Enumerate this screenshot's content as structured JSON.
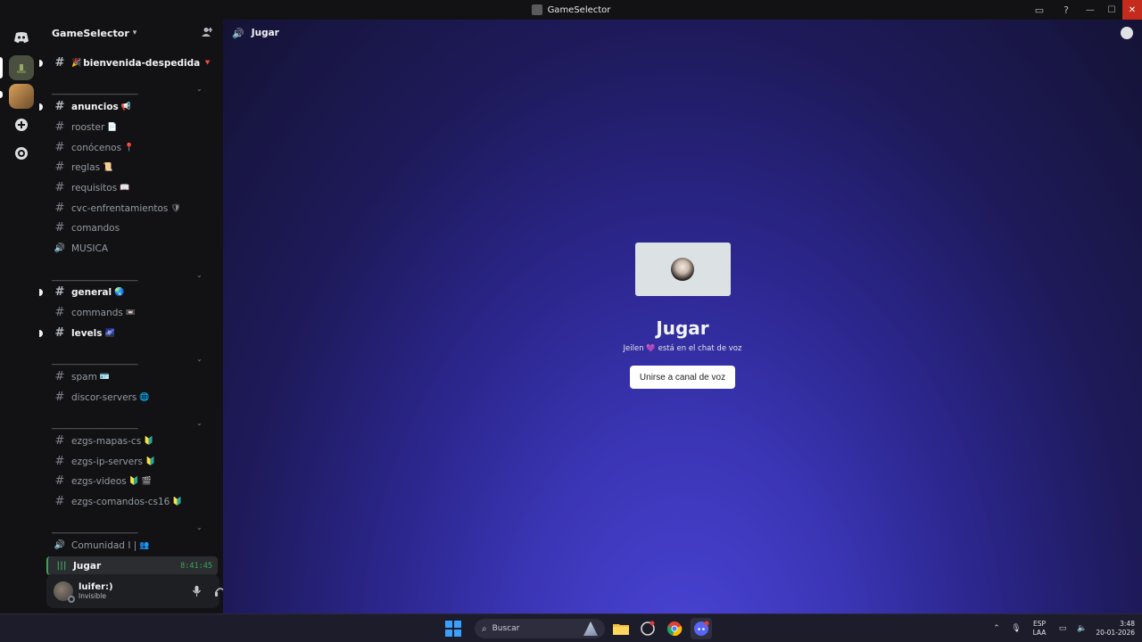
{
  "window": {
    "title": "GameSelector"
  },
  "guild": {
    "name": "GameSelector"
  },
  "channels": {
    "c0": {
      "label": "bienvenida-despedida",
      "emoji_pre": "🎉",
      "emoji_post": "🔻"
    },
    "c1": {
      "label": "anuncios",
      "emoji": "📢"
    },
    "c2": {
      "label": "rooster",
      "emoji": "📄"
    },
    "c3": {
      "label": "conócenos",
      "emoji": "📍"
    },
    "c4": {
      "label": "reglas",
      "emoji": "📜"
    },
    "c5": {
      "label": "requisitos",
      "emoji": "📖"
    },
    "c6": {
      "label": "cvc-enfrentamientos",
      "emoji": "🛡"
    },
    "c7": {
      "label": "comandos"
    },
    "c8": {
      "label": "MUSICA"
    },
    "c9": {
      "label": "general",
      "emoji": "🌏"
    },
    "c10": {
      "label": "commands",
      "emoji": "📼"
    },
    "c11": {
      "label": "levels",
      "emoji": "🌌"
    },
    "c12": {
      "label": "spam",
      "emoji": "🪪"
    },
    "c13": {
      "label": "discor-servers",
      "emoji": "🌐"
    },
    "c14": {
      "label": "ezgs-mapas-cs",
      "emoji": "🔰"
    },
    "c15": {
      "label": "ezgs-ip-servers",
      "emoji": "🔰"
    },
    "c16": {
      "label": "ezgs-videos",
      "emoji": "🔰 🎬"
    },
    "c17": {
      "label": "ezgs-comandos-cs16",
      "emoji": "🔰"
    },
    "c18": {
      "label": "Comunidad I |",
      "emoji": "👥"
    },
    "c19": {
      "label": "Jugar",
      "timer": "8:41:45"
    }
  },
  "category_separator": "________________________",
  "user": {
    "name": "luifer:)",
    "status": "Invisible"
  },
  "main": {
    "header": "Jugar",
    "voice_title": "Jugar",
    "voice_subtitle": "Jeilen 💜 está en el chat de voz",
    "join_label": "Unirse a canal de voz"
  },
  "taskbar": {
    "search_placeholder": "Buscar",
    "lang_line1": "ESP",
    "lang_line2": "LAA",
    "time": "3:48",
    "date": "20-01-2026"
  },
  "colors": {
    "accent_blurple": "#5865f2",
    "voice_green": "#3ba55c",
    "close_red": "#c42b1c"
  }
}
